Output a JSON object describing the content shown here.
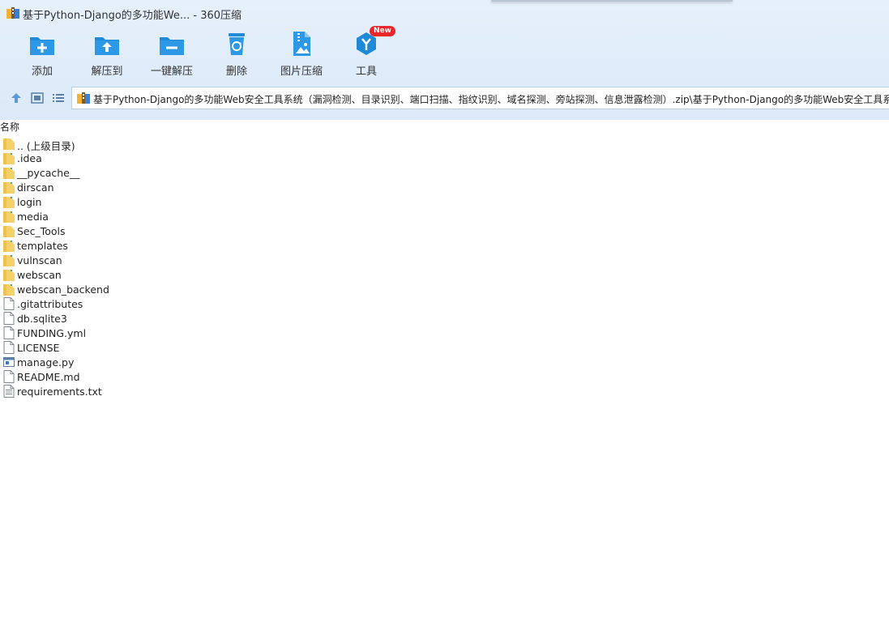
{
  "window": {
    "title": "基于Python-Django的多功能We... - 360压缩"
  },
  "toolbar": {
    "tools": [
      {
        "label": "添加",
        "icon": "add-folder-icon"
      },
      {
        "label": "解压到",
        "icon": "extract-to-icon"
      },
      {
        "label": "一键解压",
        "icon": "one-click-extract-icon"
      },
      {
        "label": "删除",
        "icon": "recycle-bin-icon"
      },
      {
        "label": "图片压缩",
        "icon": "image-compress-icon"
      },
      {
        "label": "工具",
        "icon": "tools-icon",
        "badge": "New"
      }
    ]
  },
  "nav": {
    "path": "基于Python-Django的多功能Web安全工具系统（漏洞检测、目录识别、端口扫描、指纹识别、域名探测、旁站探测、信息泄露检测）.zip\\基于Python-Django的多功能Web安全工具系统"
  },
  "file_list": {
    "column_name": "名称",
    "items": [
      {
        "name": ".. (上级目录)",
        "type": "folder"
      },
      {
        "name": ".idea",
        "type": "folder"
      },
      {
        "name": "__pycache__",
        "type": "folder"
      },
      {
        "name": "dirscan",
        "type": "folder"
      },
      {
        "name": "login",
        "type": "folder"
      },
      {
        "name": "media",
        "type": "folder"
      },
      {
        "name": "Sec_Tools",
        "type": "folder"
      },
      {
        "name": "templates",
        "type": "folder"
      },
      {
        "name": "vulnscan",
        "type": "folder"
      },
      {
        "name": "webscan",
        "type": "folder"
      },
      {
        "name": "webscan_backend",
        "type": "folder"
      },
      {
        "name": ".gitattributes",
        "type": "file"
      },
      {
        "name": "db.sqlite3",
        "type": "file"
      },
      {
        "name": "FUNDING.yml",
        "type": "file"
      },
      {
        "name": "LICENSE",
        "type": "file"
      },
      {
        "name": "manage.py",
        "type": "python"
      },
      {
        "name": "README.md",
        "type": "file"
      },
      {
        "name": "requirements.txt",
        "type": "text"
      }
    ]
  },
  "colors": {
    "toolbar_bg": "#dbe9f8",
    "icon_blue": "#1f8ad8",
    "folder_yellow": "#f6d069",
    "badge_red": "#e8262c"
  }
}
